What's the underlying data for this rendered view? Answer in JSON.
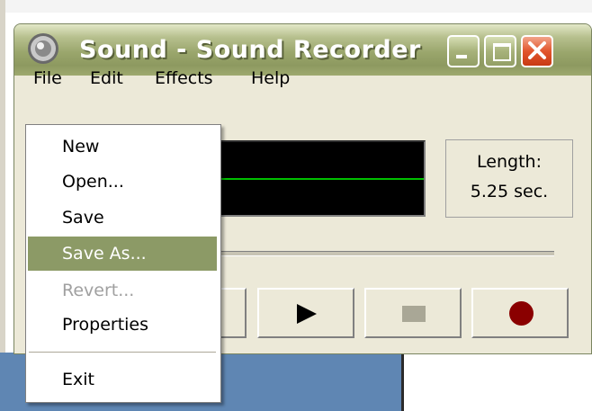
{
  "window": {
    "title": "Sound - Sound Recorder",
    "icon": "speaker-icon",
    "controls": [
      "minimize-icon",
      "maximize-icon",
      "close-icon"
    ],
    "close_symbol": "X"
  },
  "menubar": {
    "items": [
      {
        "label": "File"
      },
      {
        "label": "Edit"
      },
      {
        "label": "Effects"
      },
      {
        "label": "Help"
      }
    ]
  },
  "file_menu": {
    "items": [
      {
        "label": "New",
        "state": "normal"
      },
      {
        "label": "Open...",
        "state": "normal"
      },
      {
        "label": "Save",
        "state": "normal"
      },
      {
        "label": "Save As...",
        "state": "highlighted"
      },
      {
        "label": "Revert...",
        "state": "disabled"
      },
      {
        "label": "Properties",
        "state": "normal"
      },
      {
        "label": "Exit",
        "state": "normal"
      }
    ]
  },
  "status": {
    "length_label": "Length:",
    "length_value": "5.25 sec."
  },
  "controls": {
    "buttons": [
      "rewind-button",
      "play-icon",
      "stop-icon",
      "record-icon"
    ]
  },
  "colors": {
    "menu_highlight": "#8c9a66",
    "waveform_line": "#00c000",
    "record": "#8a0000"
  }
}
